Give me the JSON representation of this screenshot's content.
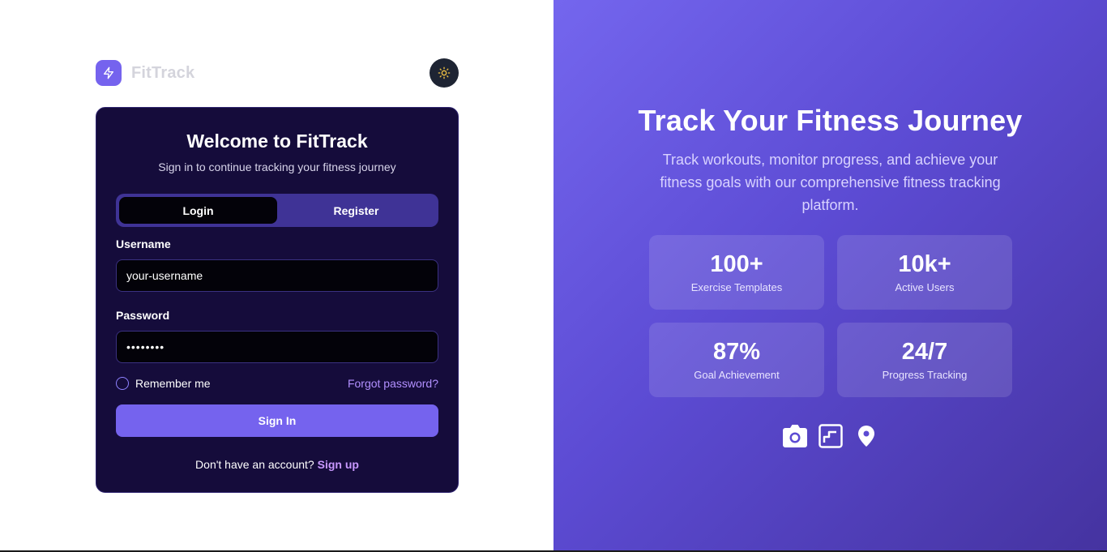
{
  "brand": {
    "name": "FitTrack",
    "accent": "#7563ee"
  },
  "theme_toggle": {
    "icon": "sun-icon"
  },
  "card": {
    "title": "Welcome to FitTrack",
    "subtitle": "Sign in to continue tracking your fitness journey",
    "tabs": [
      {
        "label": "Login",
        "active": true
      },
      {
        "label": "Register",
        "active": false
      }
    ],
    "username": {
      "label": "Username",
      "value": "your-username"
    },
    "password": {
      "label": "Password",
      "value": "••••••••"
    },
    "remember_label": "Remember me",
    "forgot_label": "Forgot password?",
    "signin_label": "Sign In",
    "footer_text": "Don't have an account?",
    "signup_label": "Sign up"
  },
  "hero": {
    "title": "Track Your Fitness Journey",
    "description": "Track workouts, monitor progress, and achieve your fitness goals with our comprehensive fitness tracking platform.",
    "stats": [
      {
        "value": "100+",
        "label": "Exercise Templates"
      },
      {
        "value": "10k+",
        "label": "Active Users"
      },
      {
        "value": "87%",
        "label": "Goal Achievement"
      },
      {
        "value": "24/7",
        "label": "Progress Tracking"
      }
    ],
    "icons": [
      "camera-icon",
      "chart-icon",
      "location-pin-icon"
    ]
  }
}
